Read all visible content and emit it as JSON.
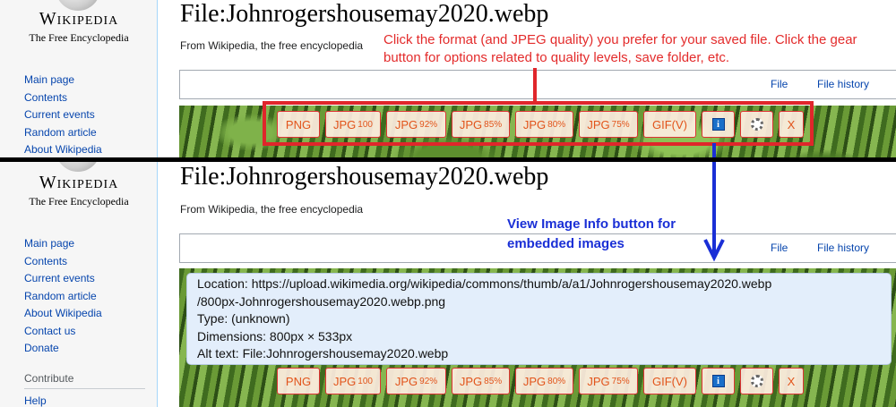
{
  "sidebar": {
    "wordmark": "Wikipedia",
    "tagline": "The Free Encyclopedia",
    "nav_top": [
      "Main page",
      "Contents",
      "Current events",
      "Random article",
      "About Wikipedia"
    ],
    "nav_bottom": [
      "Main page",
      "Contents",
      "Current events",
      "Random article",
      "About Wikipedia",
      "Contact us",
      "Donate"
    ],
    "contribute_heading": "Contribute",
    "contribute_items": [
      "Help"
    ]
  },
  "page": {
    "title": "File:Johnrogershousemay2020.webp",
    "subtitle": "From Wikipedia, the free encyclopedia"
  },
  "tabs": {
    "file": "File",
    "file_history": "File history"
  },
  "toolbar": {
    "png": "PNG",
    "jpg100_main": "JPG",
    "jpg100_q": "100",
    "jpg92_main": "JPG",
    "jpg92_q": "92%",
    "jpg85_main": "JPG",
    "jpg85_q": "85%",
    "jpg80_main": "JPG",
    "jpg80_q": "80%",
    "jpg75_main": "JPG",
    "jpg75_q": "75%",
    "gif": "GIF(V)",
    "info": "i",
    "close": "X"
  },
  "annotations": {
    "top_note": "Click the format (and JPEG quality) you prefer for your saved file. Click the gear button for options related to quality levels, save folder, etc.",
    "info_note_line1": "View Image Info button for",
    "info_note_line2": "embedded images"
  },
  "image_info": {
    "location_line1": "Location: https://upload.wikimedia.org/wikipedia/commons/thumb/a/a1/Johnrogershousemay2020.webp",
    "location_line2": "/800px-Johnrogershousemay2020.webp.png",
    "type": "Type: (unknown)",
    "dimensions": "Dimensions: 800px × 533px",
    "alt_text": "Alt text: File:Johnrogershousemay2020.webp"
  },
  "colors": {
    "toolbar_text": "#e2541b",
    "annotation_red": "#e0262b",
    "annotation_blue": "#1a2fd6",
    "link": "#0645ad"
  },
  "icons": [
    "wikipedia-globe-icon",
    "info-icon",
    "gear-icon",
    "close-icon",
    "arrow-down-icon"
  ]
}
